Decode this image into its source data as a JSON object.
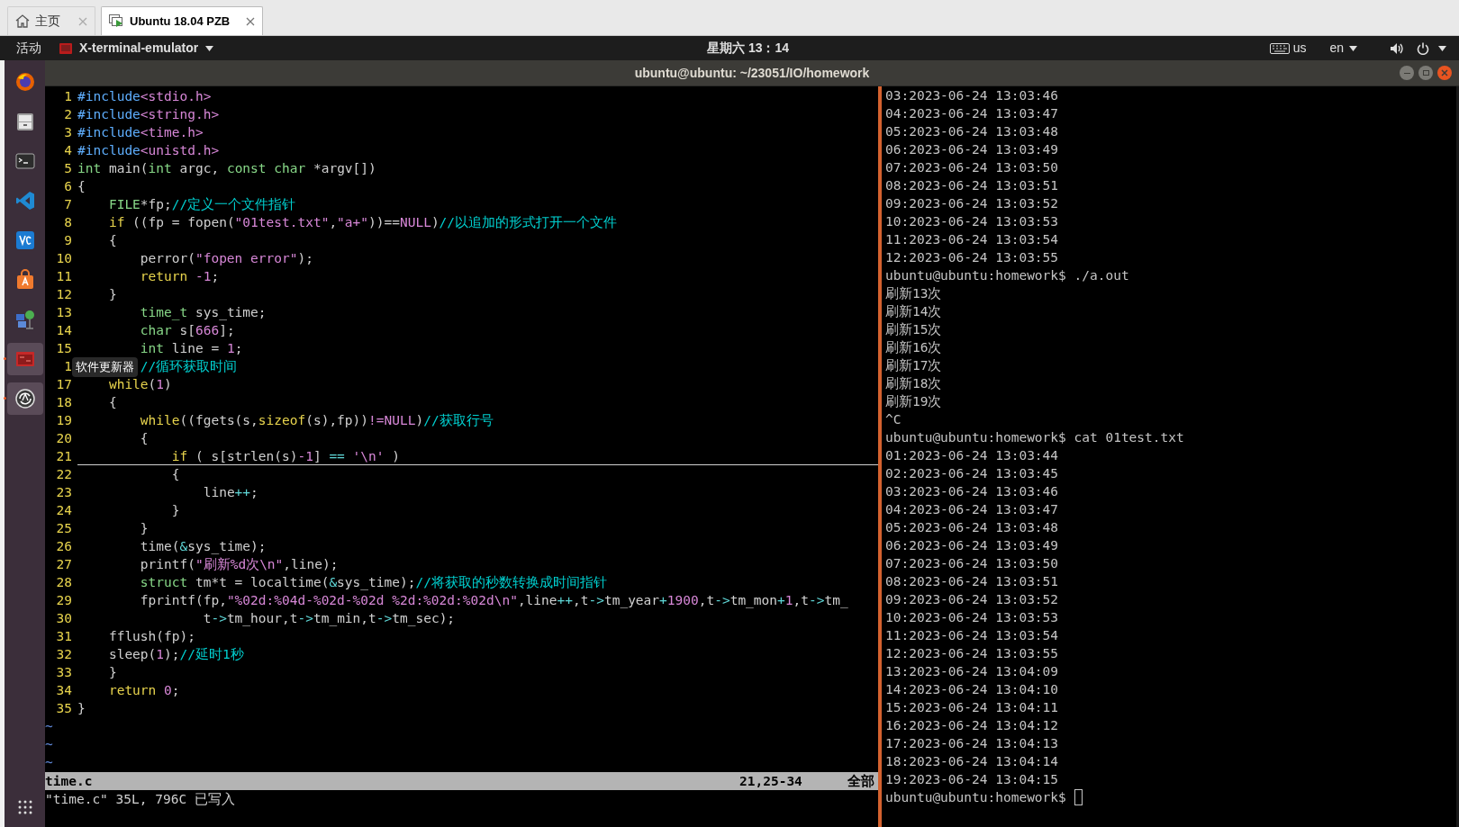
{
  "browser_tabs": [
    {
      "kind": "home",
      "label": "主页",
      "selected": false
    },
    {
      "kind": "vm",
      "label": "Ubuntu 18.04 PZB",
      "selected": true
    }
  ],
  "top_bar": {
    "activities": "活动",
    "app_menu": "X-terminal-emulator",
    "clock": "星期六 13：14",
    "keyboard_layout": "us",
    "input_method": "en"
  },
  "window": {
    "title": "ubuntu@ubuntu: ~/23051/IO/homework"
  },
  "dock": {
    "items": [
      {
        "kind": "firefox",
        "running": false
      },
      {
        "kind": "files",
        "running": false
      },
      {
        "kind": "terminal",
        "running": false
      },
      {
        "kind": "vscode",
        "running": false
      },
      {
        "kind": "vc",
        "running": false
      },
      {
        "kind": "store",
        "running": false
      },
      {
        "kind": "network",
        "running": false
      },
      {
        "kind": "redapp",
        "running": true
      },
      {
        "kind": "updater",
        "running": true
      }
    ],
    "tooltip": "软件更新器"
  },
  "editor": {
    "lines": [
      {
        "number": "1",
        "current": false,
        "tokens": [
          {
            "kind": "preproc",
            "text": "#include"
          },
          {
            "kind": "header",
            "text": "<stdio.h>"
          }
        ]
      },
      {
        "number": "2",
        "current": false,
        "tokens": [
          {
            "kind": "preproc",
            "text": "#include"
          },
          {
            "kind": "header",
            "text": "<string.h>"
          }
        ]
      },
      {
        "number": "3",
        "current": false,
        "tokens": [
          {
            "kind": "preproc",
            "text": "#include"
          },
          {
            "kind": "header",
            "text": "<time.h>"
          }
        ]
      },
      {
        "number": "4",
        "current": false,
        "tokens": [
          {
            "kind": "preproc",
            "text": "#include"
          },
          {
            "kind": "header",
            "text": "<unistd.h>"
          }
        ]
      },
      {
        "number": "5",
        "current": false,
        "tokens": [
          {
            "kind": "type",
            "text": "int"
          },
          {
            "kind": "plain",
            "text": " main("
          },
          {
            "kind": "type",
            "text": "int"
          },
          {
            "kind": "plain",
            "text": " argc, "
          },
          {
            "kind": "type",
            "text": "const "
          },
          {
            "kind": "type",
            "text": "char"
          },
          {
            "kind": "plain",
            "text": " *argv[])"
          }
        ]
      },
      {
        "number": "6",
        "current": false,
        "tokens": [
          {
            "kind": "plain",
            "text": "{"
          }
        ]
      },
      {
        "number": "7",
        "current": false,
        "tokens": [
          {
            "kind": "type",
            "text": "    FILE"
          },
          {
            "kind": "plain",
            "text": "*fp;"
          },
          {
            "kind": "comment",
            "text": "//定义一个文件指针"
          }
        ]
      },
      {
        "number": "8",
        "current": false,
        "tokens": [
          {
            "kind": "keyword",
            "text": "    if"
          },
          {
            "kind": "plain",
            "text": " ((fp = fopen("
          },
          {
            "kind": "string",
            "text": "\"01test.txt\""
          },
          {
            "kind": "plain",
            "text": ","
          },
          {
            "kind": "string",
            "text": "\"a+\""
          },
          {
            "kind": "plain",
            "text": "))=="
          },
          {
            "kind": "number",
            "text": "NULL"
          },
          {
            "kind": "plain",
            "text": ")"
          },
          {
            "kind": "comment",
            "text": "//以追加的形式打开一个文件"
          }
        ]
      },
      {
        "number": "9",
        "current": false,
        "tokens": [
          {
            "kind": "plain",
            "text": "    {"
          }
        ]
      },
      {
        "number": "10",
        "current": false,
        "tokens": [
          {
            "kind": "plain",
            "text": "        perror("
          },
          {
            "kind": "string",
            "text": "\"fopen error\""
          },
          {
            "kind": "plain",
            "text": ");"
          }
        ]
      },
      {
        "number": "11",
        "current": false,
        "tokens": [
          {
            "kind": "keyword",
            "text": "        return "
          },
          {
            "kind": "number",
            "text": "-1"
          },
          {
            "kind": "plain",
            "text": ";"
          }
        ]
      },
      {
        "number": "12",
        "current": false,
        "tokens": [
          {
            "kind": "plain",
            "text": "    }"
          }
        ]
      },
      {
        "number": "13",
        "current": false,
        "tokens": [
          {
            "kind": "type",
            "text": "        time_t"
          },
          {
            "kind": "plain",
            "text": " sys_time;"
          }
        ]
      },
      {
        "number": "14",
        "current": false,
        "tokens": [
          {
            "kind": "type",
            "text": "        char"
          },
          {
            "kind": "plain",
            "text": " s["
          },
          {
            "kind": "number",
            "text": "666"
          },
          {
            "kind": "plain",
            "text": "];"
          }
        ]
      },
      {
        "number": "15",
        "current": false,
        "tokens": [
          {
            "kind": "type",
            "text": "        int"
          },
          {
            "kind": "plain",
            "text": " line = "
          },
          {
            "kind": "number",
            "text": "1"
          },
          {
            "kind": "plain",
            "text": ";"
          }
        ]
      },
      {
        "number": "1",
        "current": false,
        "tokens": [
          {
            "kind": "comment",
            "text": "        //循环获取时间"
          }
        ]
      },
      {
        "number": "17",
        "current": false,
        "tokens": [
          {
            "kind": "keyword",
            "text": "    while"
          },
          {
            "kind": "plain",
            "text": "("
          },
          {
            "kind": "number",
            "text": "1"
          },
          {
            "kind": "plain",
            "text": ")"
          }
        ]
      },
      {
        "number": "18",
        "current": false,
        "tokens": [
          {
            "kind": "plain",
            "text": "    {"
          }
        ]
      },
      {
        "number": "19",
        "current": false,
        "tokens": [
          {
            "kind": "keyword",
            "text": "        while"
          },
          {
            "kind": "plain",
            "text": "((fgets(s,"
          },
          {
            "kind": "keyword",
            "text": "sizeof"
          },
          {
            "kind": "plain",
            "text": "(s),fp))"
          },
          {
            "kind": "number",
            "text": "!=NULL"
          },
          {
            "kind": "plain",
            "text": ")"
          },
          {
            "kind": "comment",
            "text": "//获取行号"
          }
        ]
      },
      {
        "number": "20",
        "current": false,
        "tokens": [
          {
            "kind": "plain",
            "text": "        {"
          }
        ]
      },
      {
        "number": "21",
        "current": true,
        "tokens": [
          {
            "kind": "keyword",
            "text": "            if"
          },
          {
            "kind": "plain",
            "text": " ( s[strlen(s)"
          },
          {
            "kind": "number",
            "text": "-1"
          },
          {
            "kind": "plain",
            "text": "] "
          },
          {
            "kind": "operator",
            "text": "== "
          },
          {
            "kind": "string",
            "text": "'\\n'"
          },
          {
            "kind": "plain",
            "text": " )"
          }
        ]
      },
      {
        "number": "22",
        "current": false,
        "tokens": [
          {
            "kind": "plain",
            "text": "            {"
          }
        ]
      },
      {
        "number": "23",
        "current": false,
        "tokens": [
          {
            "kind": "plain",
            "text": "                line"
          },
          {
            "kind": "operator",
            "text": "++"
          },
          {
            "kind": "plain",
            "text": ";"
          }
        ]
      },
      {
        "number": "24",
        "current": false,
        "tokens": [
          {
            "kind": "plain",
            "text": "            }"
          }
        ]
      },
      {
        "number": "25",
        "current": false,
        "tokens": [
          {
            "kind": "plain",
            "text": "        }"
          }
        ]
      },
      {
        "number": "26",
        "current": false,
        "tokens": [
          {
            "kind": "plain",
            "text": "        time("
          },
          {
            "kind": "operator",
            "text": "&"
          },
          {
            "kind": "plain",
            "text": "sys_time);"
          }
        ]
      },
      {
        "number": "27",
        "current": false,
        "tokens": [
          {
            "kind": "plain",
            "text": "        printf("
          },
          {
            "kind": "string",
            "text": "\"刷新%d次\\n\""
          },
          {
            "kind": "plain",
            "text": ",line);"
          }
        ]
      },
      {
        "number": "28",
        "current": false,
        "tokens": [
          {
            "kind": "type",
            "text": "        struct"
          },
          {
            "kind": "plain",
            "text": " tm*t = localtime("
          },
          {
            "kind": "operator",
            "text": "&"
          },
          {
            "kind": "plain",
            "text": "sys_time);"
          },
          {
            "kind": "comment",
            "text": "//将获取的秒数转换成时间指针"
          }
        ]
      },
      {
        "number": "29",
        "current": false,
        "tokens": [
          {
            "kind": "plain",
            "text": "        fprintf(fp,"
          },
          {
            "kind": "string",
            "text": "\"%02d:%04d-%02d-%02d %2d:%02d:%02d\\n\""
          },
          {
            "kind": "plain",
            "text": ",line"
          },
          {
            "kind": "operator",
            "text": "++"
          },
          {
            "kind": "plain",
            "text": ",t"
          },
          {
            "kind": "operator",
            "text": "->"
          },
          {
            "kind": "plain",
            "text": "tm_year"
          },
          {
            "kind": "operator",
            "text": "+"
          },
          {
            "kind": "number",
            "text": "1900"
          },
          {
            "kind": "plain",
            "text": ",t"
          },
          {
            "kind": "operator",
            "text": "->"
          },
          {
            "kind": "plain",
            "text": "tm_mon"
          },
          {
            "kind": "operator",
            "text": "+"
          },
          {
            "kind": "number",
            "text": "1"
          },
          {
            "kind": "plain",
            "text": ",t"
          },
          {
            "kind": "operator",
            "text": "->"
          },
          {
            "kind": "plain",
            "text": "tm_"
          }
        ]
      },
      {
        "number": "30",
        "current": false,
        "tokens": [
          {
            "kind": "plain",
            "text": "                t"
          },
          {
            "kind": "operator",
            "text": "->"
          },
          {
            "kind": "plain",
            "text": "tm_hour,t"
          },
          {
            "kind": "operator",
            "text": "->"
          },
          {
            "kind": "plain",
            "text": "tm_min,t"
          },
          {
            "kind": "operator",
            "text": "->"
          },
          {
            "kind": "plain",
            "text": "tm_sec);"
          }
        ]
      },
      {
        "number": "31",
        "current": false,
        "tokens": [
          {
            "kind": "plain",
            "text": "    fflush(fp);"
          }
        ]
      },
      {
        "number": "32",
        "current": false,
        "tokens": [
          {
            "kind": "plain",
            "text": "    sleep("
          },
          {
            "kind": "number",
            "text": "1"
          },
          {
            "kind": "plain",
            "text": ");"
          },
          {
            "kind": "comment",
            "text": "//延时1秒"
          }
        ]
      },
      {
        "number": "33",
        "current": false,
        "tokens": [
          {
            "kind": "plain",
            "text": "    }"
          }
        ]
      },
      {
        "number": "34",
        "current": false,
        "tokens": [
          {
            "kind": "keyword",
            "text": "    return "
          },
          {
            "kind": "number",
            "text": "0"
          },
          {
            "kind": "plain",
            "text": ";"
          }
        ]
      },
      {
        "number": "35",
        "current": false,
        "tokens": [
          {
            "kind": "plain",
            "text": "}"
          }
        ]
      }
    ],
    "filler": [
      "~",
      "~",
      "~"
    ],
    "status_line": {
      "file": "time.c",
      "position": "21,25-34",
      "scroll": "全部"
    },
    "message": "\"time.c\" 35L, 796C 已写入"
  },
  "terminal": {
    "lines": [
      "03:2023-06-24 13:03:46",
      "04:2023-06-24 13:03:47",
      "05:2023-06-24 13:03:48",
      "06:2023-06-24 13:03:49",
      "07:2023-06-24 13:03:50",
      "08:2023-06-24 13:03:51",
      "09:2023-06-24 13:03:52",
      "10:2023-06-24 13:03:53",
      "11:2023-06-24 13:03:54",
      "12:2023-06-24 13:03:55",
      "ubuntu@ubuntu:homework$ ./a.out",
      "刷新13次",
      "刷新14次",
      "刷新15次",
      "刷新16次",
      "刷新17次",
      "刷新18次",
      "刷新19次",
      "^C",
      "ubuntu@ubuntu:homework$ cat 01test.txt",
      "01:2023-06-24 13:03:44",
      "02:2023-06-24 13:03:45",
      "03:2023-06-24 13:03:46",
      "04:2023-06-24 13:03:47",
      "05:2023-06-24 13:03:48",
      "06:2023-06-24 13:03:49",
      "07:2023-06-24 13:03:50",
      "08:2023-06-24 13:03:51",
      "09:2023-06-24 13:03:52",
      "10:2023-06-24 13:03:53",
      "11:2023-06-24 13:03:54",
      "12:2023-06-24 13:03:55",
      "13:2023-06-24 13:04:09",
      "14:2023-06-24 13:04:10",
      "15:2023-06-24 13:04:11",
      "16:2023-06-24 13:04:12",
      "17:2023-06-24 13:04:13",
      "18:2023-06-24 13:04:14",
      "19:2023-06-24 13:04:15"
    ],
    "prompt": "ubuntu@ubuntu:homework$"
  }
}
